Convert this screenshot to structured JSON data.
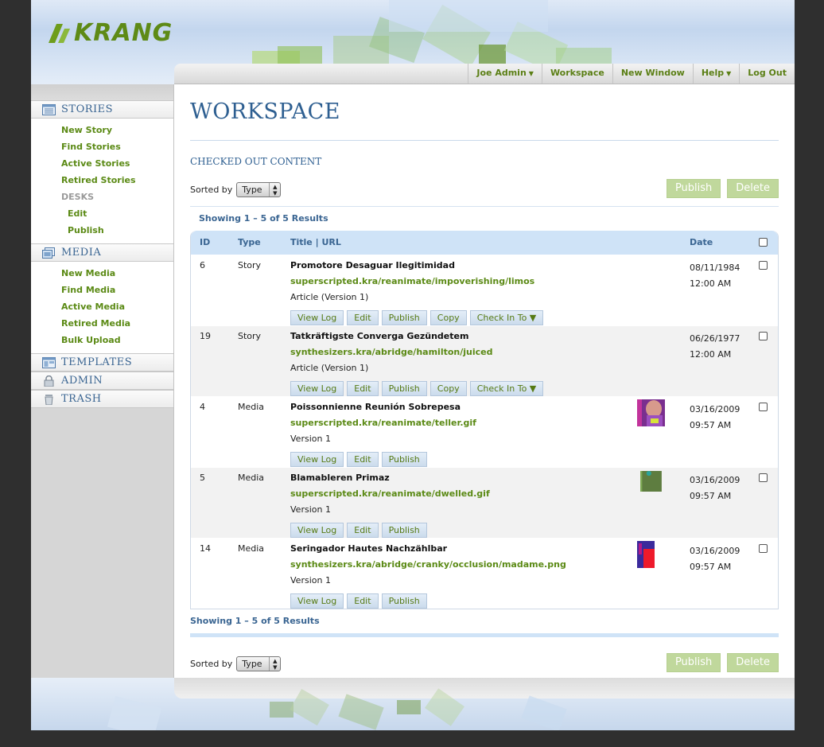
{
  "brand": {
    "logo_text": "KRANG"
  },
  "topnav": [
    {
      "label": "Joe Admin",
      "dropdown": true
    },
    {
      "label": "Workspace",
      "dropdown": false
    },
    {
      "label": "New Window",
      "dropdown": false
    },
    {
      "label": "Help",
      "dropdown": true
    },
    {
      "label": "Log Out",
      "dropdown": false
    }
  ],
  "sidebar": {
    "stories": {
      "label": "STORIES",
      "items": [
        "New Story",
        "Find Stories",
        "Active Stories",
        "Retired Stories"
      ],
      "desks_label": "DESKS",
      "desk_items": [
        "Edit",
        "Publish"
      ]
    },
    "media": {
      "label": "MEDIA",
      "items": [
        "New Media",
        "Find Media",
        "Active Media",
        "Retired Media",
        "Bulk Upload"
      ]
    },
    "templates": "TEMPLATES",
    "admin": "ADMIN",
    "trash": "TRASH"
  },
  "page": {
    "title": "WORKSPACE",
    "subtitle": "CHECKED OUT CONTENT",
    "sorted_by_label": "Sorted by",
    "sort_value": "Type",
    "publish_label": "Publish",
    "delete_label": "Delete",
    "showing": "Showing 1 – 5 of 5 Results"
  },
  "table": {
    "headers": {
      "id": "ID",
      "type": "Type",
      "title": "Title | URL",
      "date": "Date"
    },
    "rows": [
      {
        "id": "6",
        "type": "Story",
        "title": "Promotore Desaguar Ilegitimidad",
        "url": "superscripted.kra/reanimate/impoverishing/limos",
        "version": "Article (Version 1)",
        "date": "08/11/1984",
        "time": "12:00 AM",
        "buttons": [
          "View Log",
          "Edit",
          "Publish",
          "Copy",
          "Check In To ▼"
        ]
      },
      {
        "id": "19",
        "type": "Story",
        "title": "Tatkräftigste Converga Gezündetem",
        "url": "synthesizers.kra/abridge/hamilton/juiced",
        "version": "Article (Version 1)",
        "date": "06/26/1977",
        "time": "12:00 AM",
        "buttons": [
          "View Log",
          "Edit",
          "Publish",
          "Copy",
          "Check In To ▼"
        ]
      },
      {
        "id": "4",
        "type": "Media",
        "title": "Poissonnienne Reunión Sobrepesa",
        "url": "superscripted.kra/reanimate/teller.gif",
        "version": "Version 1",
        "date": "03/16/2009",
        "time": "09:57 AM",
        "thumb": "face",
        "buttons": [
          "View Log",
          "Edit",
          "Publish"
        ]
      },
      {
        "id": "5",
        "type": "Media",
        "title": "Blamableren Primaz",
        "url": "superscripted.kra/reanimate/dwelled.gif",
        "version": "Version 1",
        "date": "03/16/2009",
        "time": "09:57 AM",
        "thumb": "green",
        "buttons": [
          "View Log",
          "Edit",
          "Publish"
        ]
      },
      {
        "id": "14",
        "type": "Media",
        "title": "Seringador Hautes Nachzählbar",
        "url": "synthesizers.kra/abridge/cranky/occlusion/madame.png",
        "version": "Version 1",
        "date": "03/16/2009",
        "time": "09:57 AM",
        "thumb": "red",
        "buttons": [
          "View Log",
          "Edit",
          "Publish"
        ]
      }
    ]
  },
  "colors": {
    "accent_green": "#5b8a15",
    "accent_blue": "#2e5f91",
    "table_header": "#cfe3f7",
    "button_green": "#c0d89c"
  }
}
